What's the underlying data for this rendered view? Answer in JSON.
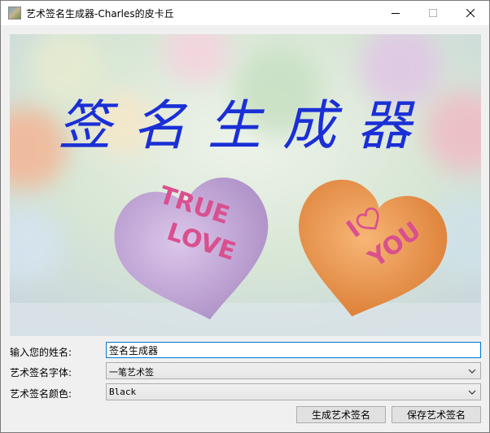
{
  "window": {
    "title": "艺术签名生成器-Charles的皮卡丘",
    "icon": "app-picture-icon",
    "controls": [
      "minimize-icon",
      "maximize-icon",
      "close-icon"
    ]
  },
  "banner": {
    "heading": "签名生成器",
    "heart_left_text": [
      "TRUE",
      "LOVE"
    ],
    "heart_right_text": [
      "I",
      "YOU"
    ],
    "colors": {
      "heading": "#1a2fd6",
      "heart_left": "#c8a9dc",
      "heart_right": "#f1a05d",
      "print": "#d9508f"
    }
  },
  "form": {
    "name_label": "输入您的姓名:",
    "name_value": "签名生成器",
    "font_label": "艺术签名字体:",
    "font_value": "一笔艺术签",
    "color_label": "艺术签名颜色:",
    "color_value": "Black"
  },
  "buttons": {
    "generate": "生成艺术签名",
    "save": "保存艺术签名"
  }
}
